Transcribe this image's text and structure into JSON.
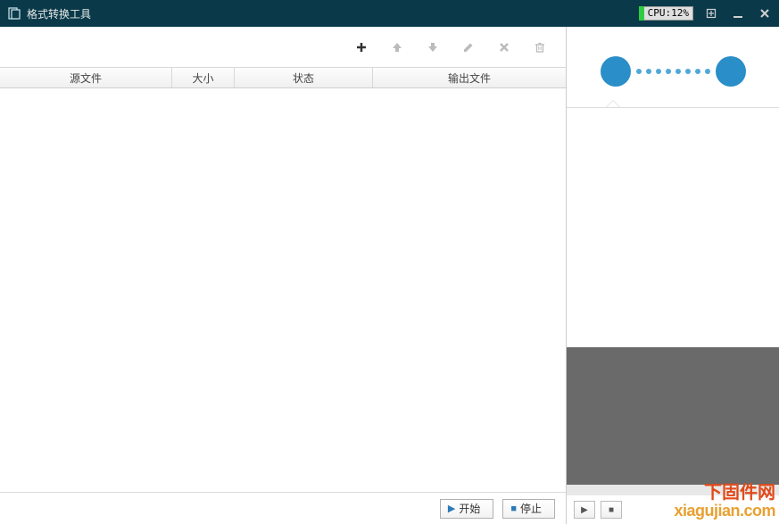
{
  "titlebar": {
    "title": "格式转换工具",
    "cpu_label": "CPU:12%"
  },
  "table": {
    "headers": {
      "source": "源文件",
      "size": "大小",
      "status": "状态",
      "output": "输出文件"
    }
  },
  "actions": {
    "start": "开始",
    "stop": "停止"
  },
  "watermark": {
    "line1": "下固件网",
    "line2": "xiagujian.com"
  },
  "colors": {
    "titlebar_bg": "#0a3a4a",
    "accent_circle": "#2a8ec8",
    "accent_dot": "#4fa8d8",
    "cpu_green": "#2ecc40",
    "preview_bg": "#6a6a6a",
    "watermark_cn": "#e04a1a",
    "watermark_en": "#e8a030"
  }
}
